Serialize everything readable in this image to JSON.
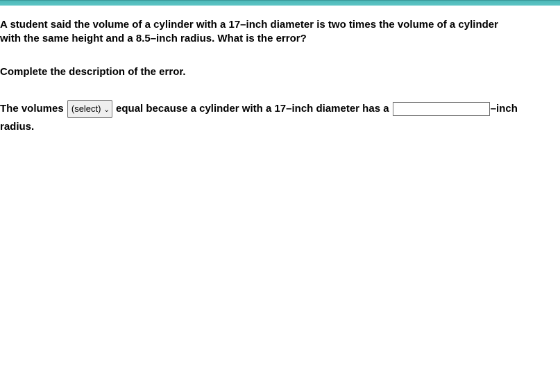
{
  "question": {
    "line1": "A student said the volume of a cylinder with a 17–inch diameter is two times the volume of a cylinder",
    "line2": "with the same height and a 8.5–inch radius. What is the error?"
  },
  "instruction": "Complete the description of the error.",
  "answer": {
    "prefix": "The volumes ",
    "select_label": "(select)",
    "mid1": " equal because a cylinder with a 17–inch diameter has a ",
    "input_value": "",
    "suffix1": "–inch",
    "line2": "radius."
  }
}
